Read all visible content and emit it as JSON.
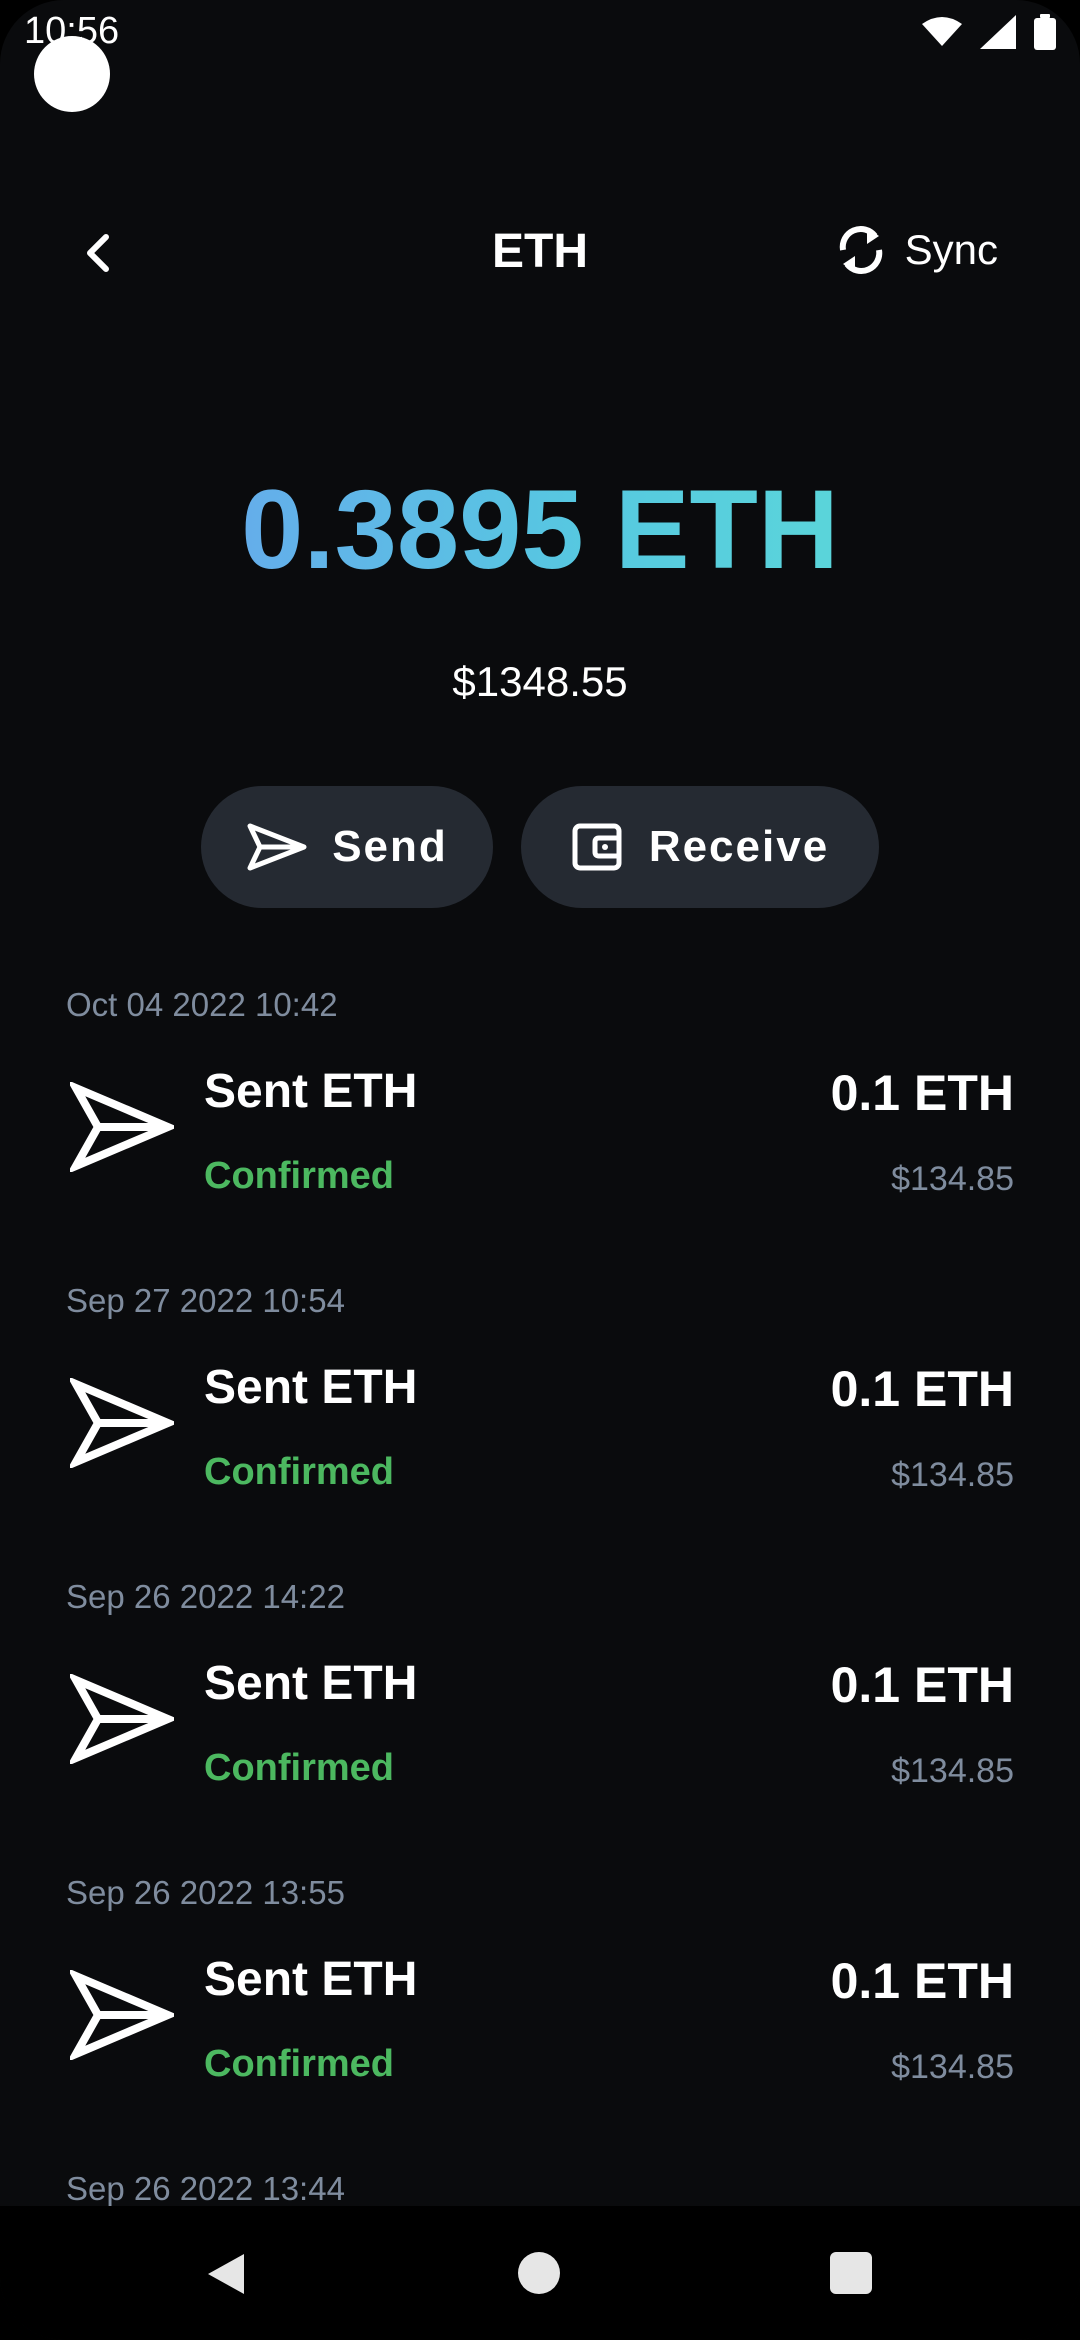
{
  "status_bar": {
    "time": "10:56"
  },
  "header": {
    "title": "ETH",
    "sync_label": "Sync"
  },
  "balance": {
    "amount": "0.3895 ETH",
    "fiat": "$1348.55"
  },
  "actions": {
    "send_label": "Send",
    "receive_label": "Receive"
  },
  "transactions": [
    {
      "date": "Oct 04 2022 10:42",
      "label": "Sent ETH",
      "status": "Confirmed",
      "amount": "0.1 ETH",
      "fiat": "$134.85"
    },
    {
      "date": "Sep 27 2022 10:54",
      "label": "Sent ETH",
      "status": "Confirmed",
      "amount": "0.1 ETH",
      "fiat": "$134.85"
    },
    {
      "date": "Sep 26 2022 14:22",
      "label": "Sent ETH",
      "status": "Confirmed",
      "amount": "0.1 ETH",
      "fiat": "$134.85"
    },
    {
      "date": "Sep 26 2022 13:55",
      "label": "Sent ETH",
      "status": "Confirmed",
      "amount": "0.1 ETH",
      "fiat": "$134.85"
    },
    {
      "date": "Sep 26 2022 13:44"
    }
  ],
  "icons": {
    "status": [
      "wifi-icon",
      "signal-icon",
      "battery-icon"
    ],
    "header": [
      "back-icon",
      "sync-icon"
    ],
    "actions": [
      "send-icon",
      "wallet-icon"
    ],
    "nav": [
      "nav-back-icon",
      "nav-home-icon",
      "nav-recent-icon"
    ]
  },
  "colors": {
    "background": "#0a0b0d",
    "button": "#252a32",
    "confirmed": "#4cb860",
    "muted": "#7f8c9e",
    "accent_start": "#6e9bf2",
    "accent_end": "#5fe0d4"
  }
}
